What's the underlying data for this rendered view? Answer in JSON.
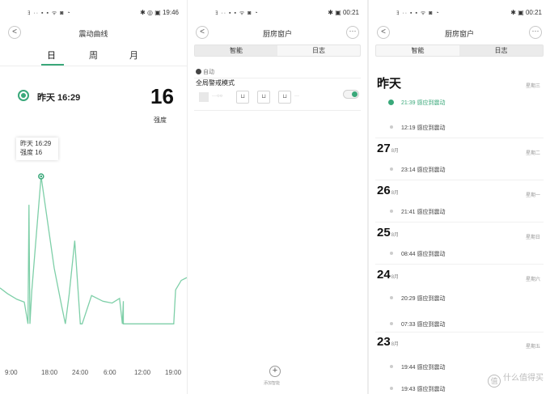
{
  "status_bars": [
    {
      "left_icons": "ﾖ ·· ▪ ▪ ᯤ ◙ ◔",
      "right": "✱ ◎ ▣ 19:46"
    },
    {
      "left_icons": "ﾖ ·· ▪ ▪ ᯤ ◙ ◔",
      "right": "✱ ▣ 00:21"
    },
    {
      "left_icons": "ﾖ ·· ▪ ▪ ᯤ ◙ ◔",
      "right": "✱ ▣ 00:21"
    }
  ],
  "panel1": {
    "title": "震动曲线",
    "back_icon": "<",
    "tabs": [
      "日",
      "周",
      "月"
    ],
    "active_tab": 0,
    "summary_time": "昨天 16:29",
    "value": "16",
    "value_label": "强度",
    "tooltip_line1": "昨天 16:29",
    "tooltip_line2": "强度 16",
    "x_ticks": [
      "9:00",
      "18:00",
      "24:00",
      "6:00",
      "12:00",
      "19:00"
    ],
    "accent": "#3aa87a"
  },
  "panel2": {
    "title": "厨房窗户",
    "back_icon": "<",
    "more_icon": "···",
    "tabs": [
      "智能",
      "日志"
    ],
    "active_tab": 0,
    "auto_label": "自动",
    "mode_title": "全局警戒模式",
    "devices_connector": "···○○",
    "devices_tail": "···",
    "add_label": "添加智能",
    "add_icon": "+",
    "toggle_on": true
  },
  "panel3": {
    "title": "厨房窗户",
    "back_icon": "<",
    "more_icon": "···",
    "tabs": [
      "智能",
      "日志"
    ],
    "active_tab": 1,
    "groups": [
      {
        "day": "昨天",
        "month": "",
        "weekday": "星期三",
        "entries": [
          "21:39  感应到震动",
          "12:19  感应到震动"
        ]
      },
      {
        "day": "27",
        "month": "8月",
        "weekday": "星期二",
        "entries": [
          "23:14  感应到震动"
        ]
      },
      {
        "day": "26",
        "month": "8月",
        "weekday": "星期一",
        "entries": [
          "21:41  感应到震动"
        ]
      },
      {
        "day": "25",
        "month": "8月",
        "weekday": "星期日",
        "entries": [
          "08:44  感应到震动"
        ]
      },
      {
        "day": "24",
        "month": "8月",
        "weekday": "星期六",
        "entries": [
          "20:29  感应到震动",
          "07:33  感应到震动"
        ]
      },
      {
        "day": "23",
        "month": "8月",
        "weekday": "星期五",
        "entries": [
          "19:44  感应到震动",
          "19:43  感应到震动"
        ]
      }
    ],
    "watermark": "什么值得买",
    "watermark_icon": "值"
  },
  "chart_data": {
    "type": "line",
    "title": "",
    "xlabel": "",
    "ylabel": "",
    "x": [
      "9:00",
      "18:00",
      "24:00",
      "6:00",
      "12:00",
      "19:00"
    ],
    "series": [
      {
        "values": [
          0,
          16,
          2,
          10,
          1,
          6
        ]
      }
    ],
    "highlight": {
      "label": "昨天 16:29",
      "value": 16
    }
  }
}
